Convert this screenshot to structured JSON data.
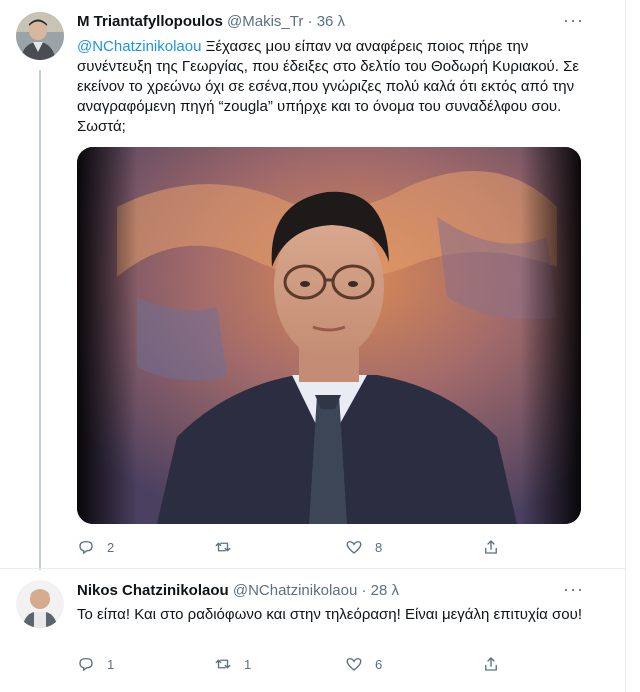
{
  "tweet1": {
    "name": "M Triantafyllopoulos",
    "handle": "@Makis_Tr",
    "dot": "·",
    "time": "36 λ",
    "more": "···",
    "mention": "@NChatzinikolaou",
    "text": " Ξέχασες μου είπαν να αναφέρεις ποιος πήρε την συνέντευξη της Γεωργίας, που έδειξες στο δελτίο του Θοδωρή Κυριακού. Σε εκείνον το χρεώνω όχι σε εσένα,που γνώριζες πολύ καλά ότι εκτός από την αναγραφόμενη πηγή “zougla” υπήρχε και το όνομα του συναδέλφου σου. Σωστά;",
    "replies": "2",
    "retweets": "",
    "likes": "8",
    "avatar_icon": "person-avatar-icon",
    "media_icon": "news-anchor-photo"
  },
  "tweet2": {
    "name": "Nikos Chatzinikolaou",
    "handle": "@NChatzinikolaou",
    "dot": "·",
    "time": "28 λ",
    "more": "···",
    "text": "Το είπα! Και στο ραδιόφωνο και στην τηλεόραση! Είναι μεγάλη επιτυχία σου!",
    "replies": "1",
    "retweets": "1",
    "likes": "6",
    "avatar_icon": "person-avatar-icon"
  },
  "colors": {
    "accent": "#1b95e0",
    "muted": "#5b7083",
    "divider": "#e6ecf0"
  }
}
